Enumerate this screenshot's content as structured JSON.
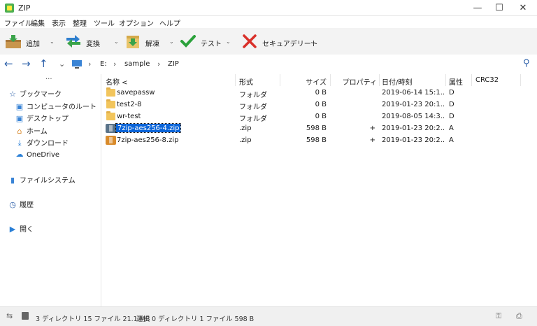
{
  "window": {
    "title": "ZIP"
  },
  "menu": [
    "ファイル",
    "編集",
    "表示",
    "整理",
    "ツール",
    "オプション",
    "ヘルプ"
  ],
  "toolbar": {
    "add": "追加",
    "convert": "変換",
    "extract": "解凍",
    "test": "テスト",
    "secure_delete": "セキュアデリート"
  },
  "nav": {
    "crumbs": [
      "E:",
      "sample",
      "ZIP"
    ]
  },
  "sidebar": {
    "more": "···",
    "bookmarks": "ブックマーク",
    "items": [
      "コンピュータのルート",
      "デスクトップ",
      "ホーム",
      "ダウンロード",
      "OneDrive"
    ],
    "filesystem": "ファイルシステム",
    "history": "履歴",
    "open": "開く"
  },
  "columns": {
    "name": "名称 <",
    "type": "形式",
    "size": "サイズ",
    "property": "プロパティ",
    "date": "日付/時刻",
    "attr": "属性",
    "crc": "CRC32"
  },
  "files": [
    {
      "name": "savepassw",
      "type": "フォルダ",
      "size": "0 B",
      "property": "",
      "date": "2019-06-14 15:1...",
      "attr": "D",
      "icon": "folder-icon"
    },
    {
      "name": "test2-8",
      "type": "フォルダ",
      "size": "0 B",
      "property": "",
      "date": "2019-01-23 20:1...",
      "attr": "D",
      "icon": "folder-icon"
    },
    {
      "name": "wr-test",
      "type": "フォルダ",
      "size": "0 B",
      "property": "",
      "date": "2019-08-05 14:3...",
      "attr": "D",
      "icon": "folder-icon"
    },
    {
      "name": "7zip-aes256-4.zip",
      "type": ".zip",
      "size": "598 B",
      "property": "+",
      "date": "2019-01-23 20:2...",
      "attr": "A",
      "icon": "zip-icon",
      "selected": true
    },
    {
      "name": "7zip-aes256-8.zip",
      "type": ".zip",
      "size": "598 B",
      "property": "+",
      "date": "2019-01-23 20:2...",
      "attr": "A",
      "icon": "zip-icon"
    }
  ],
  "status": {
    "summary": "3 ディレクトリ 15 ファイル 21.1 MB",
    "selection": "選択 0 ディレクトリ 1 ファイル 598 B"
  },
  "colors": {
    "accent": "#0a64d8",
    "folder": "#f2c55c",
    "zip1": "#5a7389",
    "zip2": "#d98b2b"
  }
}
